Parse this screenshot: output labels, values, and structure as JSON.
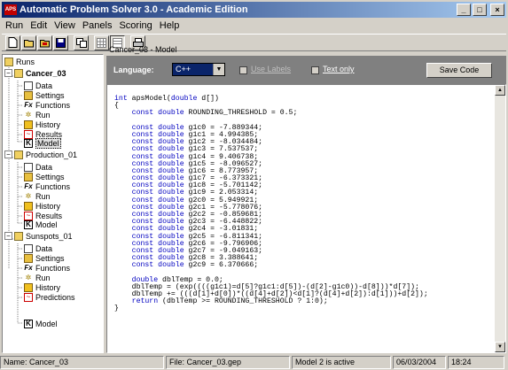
{
  "window": {
    "title": "Automatic Problem Solver 3.0 - Academic Edition",
    "app_icon_text": "APS",
    "btn_min": "_",
    "btn_max": "□",
    "btn_close": "×"
  },
  "menu": [
    "Run",
    "Edit",
    "View",
    "Panels",
    "Scoring",
    "Help"
  ],
  "tree": {
    "root": "Runs",
    "cancer": {
      "name": "Cancer_03",
      "items": [
        "Data",
        "Settings",
        "Functions",
        "Run",
        "History",
        "Results",
        "Model"
      ]
    },
    "production": {
      "name": "Production_01",
      "items": [
        "Data",
        "Settings",
        "Functions",
        "Run",
        "History",
        "Results",
        "Model"
      ]
    },
    "sunspots": {
      "name": "Sunspots_01",
      "items": [
        "Data",
        "Settings",
        "Functions",
        "Run",
        "History",
        "Predictions",
        "Model"
      ]
    }
  },
  "panel": {
    "header": "Cancer_03 - Model",
    "language_label": "Language:",
    "language_value": "C++",
    "use_labels": "Use Labels",
    "text_only": "Text only",
    "save_code": "Save Code"
  },
  "code": {
    "lines": [
      "int apsModel(double d[])",
      "{",
      "    const double ROUNDING_THRESHOLD = 0.5;",
      "",
      "    const double g1c0 = -7.889344;",
      "    const double g1c1 = 4.994385;",
      "    const double g1c2 = -8.034484;",
      "    const double g1c3 = 7.537537;",
      "    const double g1c4 = 9.406738;",
      "    const double g1c5 = -8.096527;",
      "    const double g1c6 = 8.773957;",
      "    const double g1c7 = -6.373321;",
      "    const double g1c8 = -5.701142;",
      "    const double g1c9 = 2.053314;",
      "    const double g2c0 = 5.949921;",
      "    const double g2c1 = -5.778076;",
      "    const double g2c2 = -0.859681;",
      "    const double g2c3 = -6.448822;",
      "    const double g2c4 = -3.01831;",
      "    const double g2c5 = -6.811341;",
      "    const double g2c6 = -9.796906;",
      "    const double g2c7 = -9.049163;",
      "    const double g2c8 = 3.388641;",
      "    const double g2c9 = 6.370666;",
      "",
      "    double dblTemp = 0.0;",
      "    dblTemp = (exp((((g1c1)=d[5]?g1c1:d[5])-(d[2]-g1c0))-d[8]))*d[7]);",
      "    dblTemp += (((d[1]+d[0])*((d[4]+d[2])<d[1]?(d[4]+d[2]):d[1]))+d[2]);",
      "    return (dblTemp >= ROUNDING_THRESHOLD ? 1:0);",
      "}"
    ]
  },
  "status": {
    "name": "Name: Cancer_03",
    "file": "File: Cancer_03.gep",
    "model": "Model 2 is active",
    "date": "06/03/2004",
    "time": "18:24"
  }
}
